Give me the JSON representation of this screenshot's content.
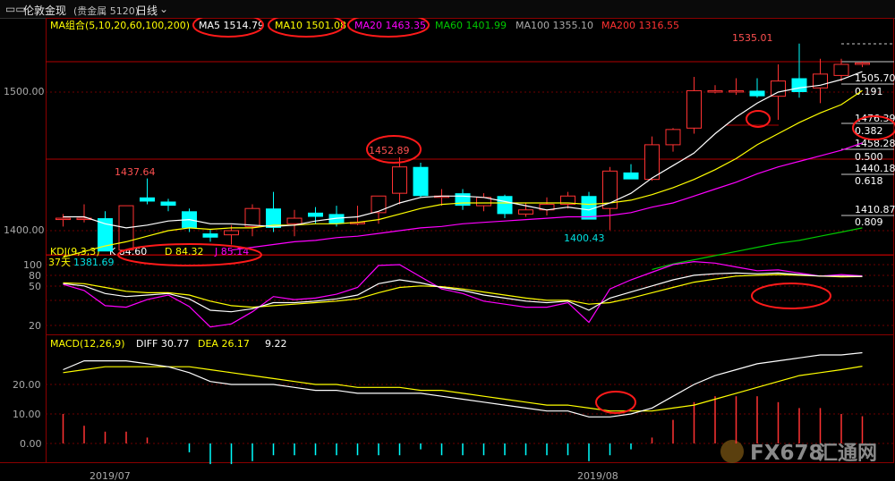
{
  "window": {
    "icon": "window-restore-icon",
    "instrument": "伦敦金现",
    "instrument_meta": "(贵金属 5120)",
    "period": "日线",
    "period_icon": "chevron-down-icon"
  },
  "colors": {
    "up": "#ff3232",
    "down": "#00ffff",
    "ma5": "#ffffff",
    "ma10": "#ffff00",
    "ma20": "#ff00ff",
    "ma60": "#00c800",
    "grid": "#7a0000",
    "axis": "#aaaaaa"
  },
  "ma_legend": {
    "title": "MA组合(5,10,20,60,100,200)",
    "items": [
      {
        "label": "MA5 1514.79",
        "color": "#ffffff",
        "circled": true
      },
      {
        "label": "MA10 1501.08",
        "color": "#ffff00",
        "circled": true
      },
      {
        "label": "MA20 1463.35",
        "color": "#ff00ff",
        "circled": true
      },
      {
        "label": "MA60 1401.99",
        "color": "#00c800",
        "circled": false
      },
      {
        "label": "MA100 1355.10",
        "color": "#aaaaaa",
        "circled": false
      },
      {
        "label": "MA200 1316.55",
        "color": "#ff3232",
        "circled": false
      }
    ]
  },
  "price_axis": {
    "ticks": [
      "1500.00",
      "1400.00"
    ]
  },
  "price_annotations": {
    "high_1535": "1535.01",
    "peak_1452": "1452.89",
    "peak_1437": "1437.64",
    "low_1400": "1400.43",
    "days_label": "37天",
    "days_value": "1381.69"
  },
  "fib_levels": [
    {
      "price": "1505.70",
      "ratio": "0.191"
    },
    {
      "price": "1476.39",
      "ratio": "0.382"
    },
    {
      "price": "1458.28",
      "ratio": "0.500"
    },
    {
      "price": "1440.18",
      "ratio": "0.618"
    },
    {
      "price": "1410.87",
      "ratio": "0.809"
    }
  ],
  "kdj": {
    "title": "KDJ(9,3,3)",
    "k_label": "K 84.60",
    "d_label": "D 84.32",
    "j_label": "J 85.14",
    "ticks": [
      "100",
      "80",
      "50",
      "20"
    ]
  },
  "macd": {
    "title": "MACD(12,26,9)",
    "diff_label": "DIFF 30.77",
    "dea_label": "DEA 26.17",
    "macd_label": "9.22",
    "ticks": [
      "20.00",
      "10.00",
      "0.00"
    ]
  },
  "dates": [
    "2019/07",
    "2019/08"
  ],
  "watermark": {
    "brand": "FX678",
    "cn": "汇通网"
  },
  "chart_data": [
    {
      "type": "candlestick",
      "title": "伦敦金现 日线",
      "ylim": [
        1372,
        1545
      ],
      "candles": [
        {
          "o": 1409,
          "h": 1412,
          "l": 1403,
          "c": 1409
        },
        {
          "o": 1409,
          "h": 1419,
          "l": 1406,
          "c": 1409
        },
        {
          "o": 1409,
          "h": 1414,
          "l": 1386,
          "c": 1385
        },
        {
          "o": 1386,
          "h": 1408,
          "l": 1386,
          "c": 1418
        },
        {
          "o": 1424,
          "h": 1437.64,
          "l": 1419,
          "c": 1421
        },
        {
          "o": 1421,
          "h": 1423,
          "l": 1414,
          "c": 1418
        },
        {
          "o": 1414,
          "h": 1416,
          "l": 1399,
          "c": 1402
        },
        {
          "o": 1398,
          "h": 1401,
          "l": 1392,
          "c": 1395
        },
        {
          "o": 1397,
          "h": 1404,
          "l": 1390,
          "c": 1400
        },
        {
          "o": 1403,
          "h": 1419,
          "l": 1396,
          "c": 1416
        },
        {
          "o": 1416,
          "h": 1428,
          "l": 1399,
          "c": 1402
        },
        {
          "o": 1405,
          "h": 1415,
          "l": 1396,
          "c": 1409
        },
        {
          "o": 1413,
          "h": 1417,
          "l": 1405,
          "c": 1410
        },
        {
          "o": 1412,
          "h": 1418,
          "l": 1403,
          "c": 1405
        },
        {
          "o": 1405,
          "h": 1418,
          "l": 1404,
          "c": 1406
        },
        {
          "o": 1413,
          "h": 1424,
          "l": 1405,
          "c": 1425
        },
        {
          "o": 1427,
          "h": 1452.89,
          "l": 1419,
          "c": 1446
        },
        {
          "o": 1446,
          "h": 1449,
          "l": 1424,
          "c": 1425
        },
        {
          "o": 1425,
          "h": 1430,
          "l": 1418,
          "c": 1425
        },
        {
          "o": 1427,
          "h": 1430,
          "l": 1415,
          "c": 1418
        },
        {
          "o": 1418,
          "h": 1427,
          "l": 1414,
          "c": 1424
        },
        {
          "o": 1425,
          "h": 1426,
          "l": 1409,
          "c": 1412
        },
        {
          "o": 1412,
          "h": 1420,
          "l": 1410,
          "c": 1415
        },
        {
          "o": 1415,
          "h": 1424,
          "l": 1411,
          "c": 1419
        },
        {
          "o": 1419,
          "h": 1428,
          "l": 1416,
          "c": 1425
        },
        {
          "o": 1425,
          "h": 1428,
          "l": 1415,
          "c": 1408
        },
        {
          "o": 1416,
          "h": 1446,
          "l": 1400.43,
          "c": 1443
        },
        {
          "o": 1442,
          "h": 1448,
          "l": 1438,
          "c": 1437
        },
        {
          "o": 1437,
          "h": 1468,
          "l": 1436,
          "c": 1462
        },
        {
          "o": 1462,
          "h": 1474,
          "l": 1457,
          "c": 1473
        },
        {
          "o": 1474,
          "h": 1511,
          "l": 1470,
          "c": 1501
        },
        {
          "o": 1500,
          "h": 1505,
          "l": 1499,
          "c": 1501
        },
        {
          "o": 1501,
          "h": 1510,
          "l": 1498,
          "c": 1501
        },
        {
          "o": 1501,
          "h": 1510,
          "l": 1496,
          "c": 1497
        },
        {
          "o": 1497,
          "h": 1520,
          "l": 1480,
          "c": 1508
        },
        {
          "o": 1510,
          "h": 1535.01,
          "l": 1496,
          "c": 1500
        },
        {
          "o": 1503,
          "h": 1524,
          "l": 1492,
          "c": 1513
        },
        {
          "o": 1512,
          "h": 1524,
          "l": 1508,
          "c": 1520
        },
        {
          "o": 1520,
          "h": 1522,
          "l": 1518,
          "c": 1521
        }
      ],
      "series": [
        {
          "name": "MA5",
          "values": [
            1410,
            1410,
            1405,
            1402,
            1404,
            1407,
            1408,
            1405,
            1405,
            1404,
            1403,
            1404,
            1407,
            1409,
            1410,
            1414,
            1420,
            1424,
            1425,
            1425,
            1424,
            1421,
            1418,
            1415,
            1417,
            1415,
            1420,
            1427,
            1438,
            1447,
            1456,
            1470,
            1482,
            1492,
            1500,
            1503,
            1505,
            1509,
            1514.79
          ]
        },
        {
          "name": "MA10",
          "values": [
            1381,
            1385,
            1389,
            1392,
            1396,
            1400,
            1402,
            1401,
            1402,
            1402,
            1404,
            1404,
            1405,
            1405,
            1406,
            1408,
            1412,
            1416,
            1419,
            1420,
            1420,
            1420,
            1420,
            1420,
            1420,
            1419,
            1420,
            1422,
            1426,
            1431,
            1437,
            1444,
            1452,
            1462,
            1470,
            1478,
            1485,
            1491,
            1501.08
          ]
        },
        {
          "name": "MA20",
          "values": [
            null,
            null,
            null,
            null,
            null,
            null,
            null,
            null,
            1386,
            1388,
            1390,
            1392,
            1393,
            1395,
            1396,
            1398,
            1400,
            1402,
            1403,
            1405,
            1406,
            1407,
            1408,
            1409,
            1410,
            1410,
            1411,
            1413,
            1417,
            1420,
            1425,
            1430,
            1435,
            1441,
            1446,
            1450,
            1454,
            1458,
            1463.35
          ]
        },
        {
          "name": "MA60",
          "values": [
            null,
            null,
            null,
            null,
            null,
            null,
            null,
            null,
            null,
            null,
            null,
            null,
            null,
            null,
            null,
            null,
            null,
            null,
            null,
            null,
            null,
            null,
            null,
            null,
            null,
            null,
            null,
            null,
            1372,
            1376,
            1379,
            1382,
            1385,
            1388,
            1391,
            1393,
            1396,
            1399,
            1401.99
          ]
        }
      ]
    },
    {
      "type": "line",
      "title": "KDJ(9,3,3)",
      "ylim": [
        0,
        110
      ],
      "series": [
        {
          "name": "K",
          "values": [
            75,
            72,
            62,
            58,
            60,
            62,
            55,
            40,
            38,
            42,
            50,
            50,
            52,
            55,
            60,
            75,
            80,
            76,
            70,
            66,
            60,
            56,
            52,
            50,
            52,
            40,
            56,
            64,
            72,
            80,
            86,
            88,
            89,
            88,
            89,
            87,
            85,
            85,
            84.6
          ]
        },
        {
          "name": "D",
          "values": [
            76,
            75,
            70,
            65,
            63,
            63,
            60,
            52,
            46,
            44,
            46,
            48,
            50,
            52,
            55,
            63,
            70,
            72,
            71,
            68,
            64,
            60,
            56,
            53,
            53,
            48,
            50,
            56,
            63,
            70,
            77,
            81,
            85,
            86,
            87,
            86,
            85,
            84,
            84.32
          ]
        },
        {
          "name": "J",
          "values": [
            74,
            66,
            46,
            44,
            54,
            60,
            45,
            18,
            22,
            38,
            58,
            54,
            56,
            61,
            70,
            99,
            100,
            84,
            68,
            62,
            52,
            48,
            44,
            44,
            50,
            24,
            68,
            80,
            90,
            100,
            104,
            102,
            97,
            92,
            93,
            89,
            85,
            87,
            85.14
          ]
        }
      ]
    },
    {
      "type": "bar",
      "title": "MACD(12,26,9)",
      "ylim": [
        -8,
        40
      ],
      "series": [
        {
          "name": "DIFF",
          "values": [
            25,
            28,
            28,
            28,
            27,
            26,
            24,
            21,
            20,
            20,
            20,
            19,
            18,
            18,
            17,
            17,
            17,
            17,
            16,
            15,
            14,
            13,
            12,
            11,
            11,
            9,
            9,
            10,
            12,
            16,
            20,
            23,
            25,
            27,
            28,
            29,
            30,
            30,
            30.77
          ]
        },
        {
          "name": "DEA",
          "values": [
            24,
            25,
            26,
            26,
            26,
            26,
            26,
            25,
            24,
            23,
            22,
            21,
            20,
            20,
            19,
            19,
            19,
            18,
            18,
            17,
            16,
            15,
            14,
            13,
            13,
            12,
            11,
            11,
            11,
            12,
            13,
            15,
            17,
            19,
            21,
            23,
            24,
            25,
            26.17
          ]
        },
        {
          "name": "MACD",
          "values": [
            10,
            6,
            4,
            4,
            2,
            0,
            -3,
            -7,
            -7,
            -6,
            -4,
            -4,
            -4,
            -4,
            -4,
            -4,
            -4,
            -2,
            -4,
            -4,
            -4,
            -4,
            -4,
            -4,
            -4,
            -6,
            -4,
            -2,
            2,
            8,
            14,
            16,
            16,
            16,
            14,
            12,
            12,
            10,
            9.22
          ]
        }
      ]
    }
  ]
}
